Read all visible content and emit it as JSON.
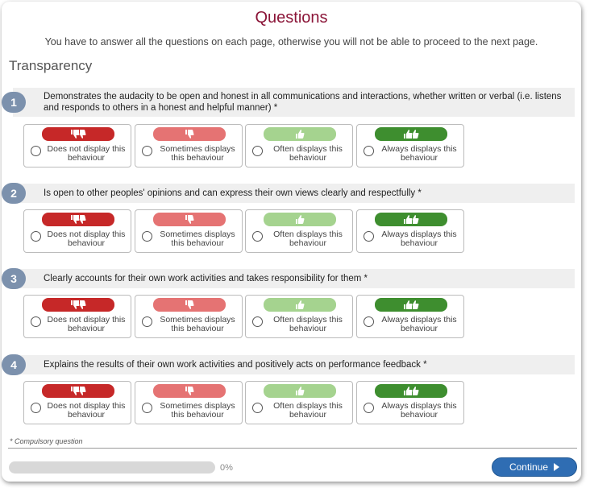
{
  "header": {
    "title": "Questions",
    "instructions": "You have to answer all the questions on each page, otherwise you will not be able to proceed to the next page."
  },
  "section_title": "Transparency",
  "scale": [
    {
      "label": "Does not display this behaviour",
      "icon": "double-thumbs-down-icon",
      "color": "#c62828"
    },
    {
      "label": "Sometimes displays this behaviour",
      "icon": "thumbs-down-icon",
      "color": "#e57373"
    },
    {
      "label": "Often displays this behaviour",
      "icon": "thumbs-up-icon",
      "color": "#a5d38f"
    },
    {
      "label": "Always displays this behaviour",
      "icon": "double-thumbs-up-icon",
      "color": "#3e8e2f"
    }
  ],
  "questions": [
    {
      "number": "1",
      "text": "Demonstrates the audacity to be open and honest in all communications and interactions, whether written or verbal (i.e. listens and responds to others in a honest and helpful manner) *"
    },
    {
      "number": "2",
      "text": "Is open to other peoples' opinions and can express their own views clearly and respectfully *"
    },
    {
      "number": "3",
      "text": "Clearly accounts for their own work activities and takes responsibility for them *"
    },
    {
      "number": "4",
      "text": "Explains the results of their own work activities and positively acts on performance feedback *"
    }
  ],
  "footer": {
    "compulsory_note": "* Compulsory question",
    "progress_value": 0,
    "progress_text": "0%",
    "continue_label": "Continue"
  }
}
